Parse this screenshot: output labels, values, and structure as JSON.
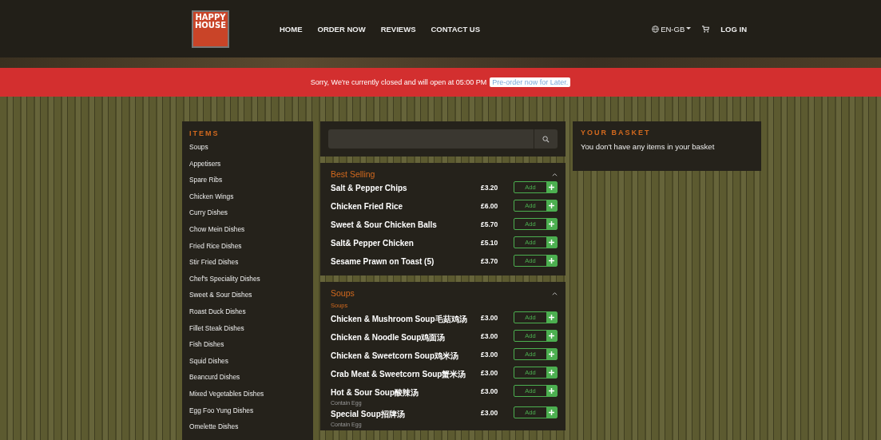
{
  "header": {
    "logo": "HAPPY HOUSE",
    "nav": [
      {
        "label": "HOME"
      },
      {
        "label": "ORDER NOW"
      },
      {
        "label": "REVIEWS"
      },
      {
        "label": "CONTACT US"
      }
    ],
    "language": "EN-GB",
    "login": "LOG IN"
  },
  "banner": {
    "message": "Sorry, We're currently closed and will open at 05:00 PM",
    "link": "Pre-order now for Later."
  },
  "items_panel": {
    "title": "ITEMS",
    "items": [
      "Soups",
      "Appetisers",
      "Spare Ribs",
      "Chicken Wings",
      "Curry Dishes",
      "Chow Mein Dishes",
      "Fried Rice Dishes",
      "Stir Fried Dishes",
      "Chef's Speciality Dishes",
      "Sweet & Sour Dishes",
      "Roast Duck Dishes",
      "Fillet Steak Dishes",
      "Fish Dishes",
      "Squid Dishes",
      "Beancurd Dishes",
      "Mixed Vegetables Dishes",
      "Egg Foo Yung Dishes",
      "Omelette Dishes"
    ]
  },
  "menu": {
    "sections": [
      {
        "title": "Best Selling",
        "expanded": true,
        "dishes": [
          {
            "name": "Salt & Pepper Chips",
            "price": "£3.20",
            "button": "Add"
          },
          {
            "name": "Chicken Fried Rice",
            "price": "£6.00",
            "button": "Add"
          },
          {
            "name": "Sweet & Sour Chicken Balls",
            "price": "£5.70",
            "button": "Add"
          },
          {
            "name": "Salt& Pepper Chicken",
            "price": "£5.10",
            "button": "Add"
          },
          {
            "name": "Sesame Prawn on Toast (5)",
            "price": "£3.70",
            "button": "Add"
          }
        ]
      },
      {
        "title": "Soups",
        "expanded": true,
        "subtitle": "Soups",
        "dishes": [
          {
            "name": "Chicken & Mushroom Soup毛菇鸡汤",
            "price": "£3.00",
            "button": "Add"
          },
          {
            "name": "Chicken & Noodle Soup鸡面汤",
            "price": "£3.00",
            "button": "Add"
          },
          {
            "name": "Chicken & Sweetcorn Soup鸡米汤",
            "price": "£3.00",
            "button": "Add"
          },
          {
            "name": "Crab Meat & Sweetcorn Soup蟹米汤",
            "price": "£3.00",
            "button": "Add"
          },
          {
            "name": "Hot & Sour Soup酸辣汤",
            "note": "Contain Egg",
            "price": "£3.00",
            "button": "Add"
          },
          {
            "name": "Special Soup招牌汤",
            "note": "Contain Egg",
            "price": "£3.00",
            "button": "Add"
          }
        ]
      }
    ]
  },
  "basket": {
    "title": "YOUR BASKET",
    "message": "You don't have any items in your basket"
  }
}
